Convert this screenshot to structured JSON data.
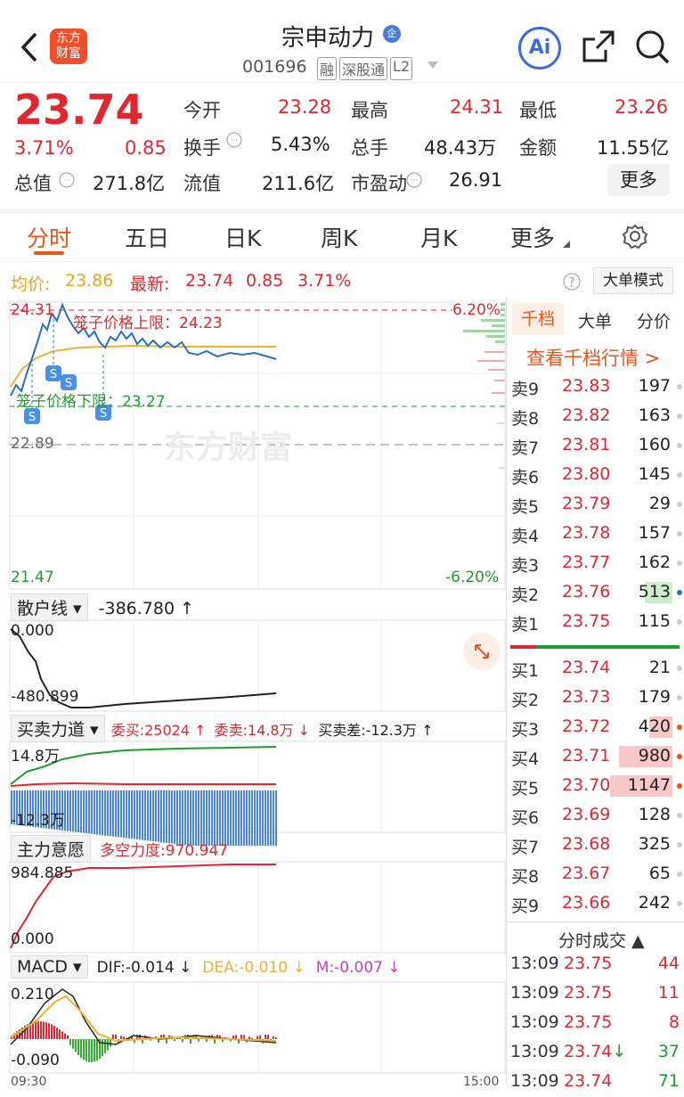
{
  "header": {
    "title": "宗申动力",
    "company_badge": "企",
    "code": "001696",
    "tags": [
      "融",
      "深股通",
      "L2"
    ],
    "logo": "东方\n财富",
    "ai_label": "Ai"
  },
  "quote": {
    "price": "23.74",
    "pct": "3.71%",
    "chg": "0.85",
    "fields": [
      {
        "label": "今开",
        "value": "23.28",
        "color": "red"
      },
      {
        "label": "最高",
        "value": "24.31",
        "color": "red"
      },
      {
        "label": "最低",
        "value": "23.26",
        "color": "red"
      },
      {
        "label": "换手",
        "value": "5.43%",
        "color": "black"
      },
      {
        "label": "总手",
        "value": "48.43万",
        "color": "black"
      },
      {
        "label": "金额",
        "value": "11.55亿",
        "color": "black"
      },
      {
        "label": "总值",
        "value": "271.8亿",
        "color": "black"
      },
      {
        "label": "流值",
        "value": "211.6亿",
        "color": "black"
      },
      {
        "label": "市盈动",
        "value": "26.91",
        "color": "black"
      }
    ],
    "more_button": "更多"
  },
  "tabs": [
    "分时",
    "五日",
    "日K",
    "周K",
    "月K",
    "更多"
  ],
  "infobar": {
    "avg_label": "均价:",
    "avg": "23.86",
    "latest_label": "最新:",
    "latest": "23.74",
    "chg": "0.85",
    "pct": "3.71%",
    "big_order": "大单模式"
  },
  "chart": {
    "high": "24.31",
    "mid": "22.89",
    "low": "21.47",
    "pct_high": "6.20%",
    "pct_low": "-6.20%",
    "upper_limit": "笼子价格上限：24.23",
    "lower_limit": "笼子价格下限：23.27",
    "watermark": "东方财富",
    "time_start": "09:30",
    "time_end": "15:00"
  },
  "indicators": {
    "retail": {
      "name": "散户线",
      "value": "-386.780 ↑",
      "top": "0.000",
      "bottom": "-480.899"
    },
    "buysell": {
      "name": "买卖力道",
      "buy": "委买:25024 ↑",
      "sell": "委卖:14.8万 ↓",
      "diff": "买卖差:-12.3万 ↑",
      "top": "14.8万",
      "bottom": "-12.3万"
    },
    "main": {
      "name": "主力意愿",
      "value": "多空力度:970.947",
      "top": "984.885",
      "bottom": "0.000"
    },
    "macd": {
      "name": "MACD",
      "dif": "DIF:-0.014 ↓",
      "dea": "DEA:-0.010 ↓",
      "m": "M:-0.007 ↓",
      "top": "0.210",
      "bottom": "-0.090"
    }
  },
  "book": {
    "tabs": [
      "千档",
      "大单",
      "分价"
    ],
    "link": "查看千档行情 >",
    "asks": [
      {
        "k": "卖9",
        "p": "23.83",
        "v": "197"
      },
      {
        "k": "卖8",
        "p": "23.82",
        "v": "163"
      },
      {
        "k": "卖7",
        "p": "23.81",
        "v": "160"
      },
      {
        "k": "卖6",
        "p": "23.80",
        "v": "145"
      },
      {
        "k": "卖5",
        "p": "23.79",
        "v": "29"
      },
      {
        "k": "卖4",
        "p": "23.78",
        "v": "157"
      },
      {
        "k": "卖3",
        "p": "23.77",
        "v": "162"
      },
      {
        "k": "卖2",
        "p": "23.76",
        "v": "513"
      },
      {
        "k": "卖1",
        "p": "23.75",
        "v": "115"
      }
    ],
    "bids": [
      {
        "k": "买1",
        "p": "23.74",
        "v": "21"
      },
      {
        "k": "买2",
        "p": "23.73",
        "v": "179"
      },
      {
        "k": "买3",
        "p": "23.72",
        "v": "420"
      },
      {
        "k": "买4",
        "p": "23.71",
        "v": "980"
      },
      {
        "k": "买5",
        "p": "23.70",
        "v": "1147"
      },
      {
        "k": "买6",
        "p": "23.69",
        "v": "128"
      },
      {
        "k": "买7",
        "p": "23.68",
        "v": "325"
      },
      {
        "k": "买8",
        "p": "23.67",
        "v": "65"
      },
      {
        "k": "买9",
        "p": "23.66",
        "v": "242"
      }
    ],
    "trades_title": "分时成交 ▲",
    "trades": [
      {
        "t": "13:09",
        "p": "23.75",
        "v": "44",
        "c": "red"
      },
      {
        "t": "13:09",
        "p": "23.75",
        "v": "11",
        "c": "red"
      },
      {
        "t": "13:09",
        "p": "23.75",
        "v": "8",
        "c": "red"
      },
      {
        "t": "13:09",
        "p": "23.74↓",
        "v": "37",
        "c": "green"
      },
      {
        "t": "13:09",
        "p": "23.74",
        "v": "71",
        "c": "green"
      }
    ]
  }
}
